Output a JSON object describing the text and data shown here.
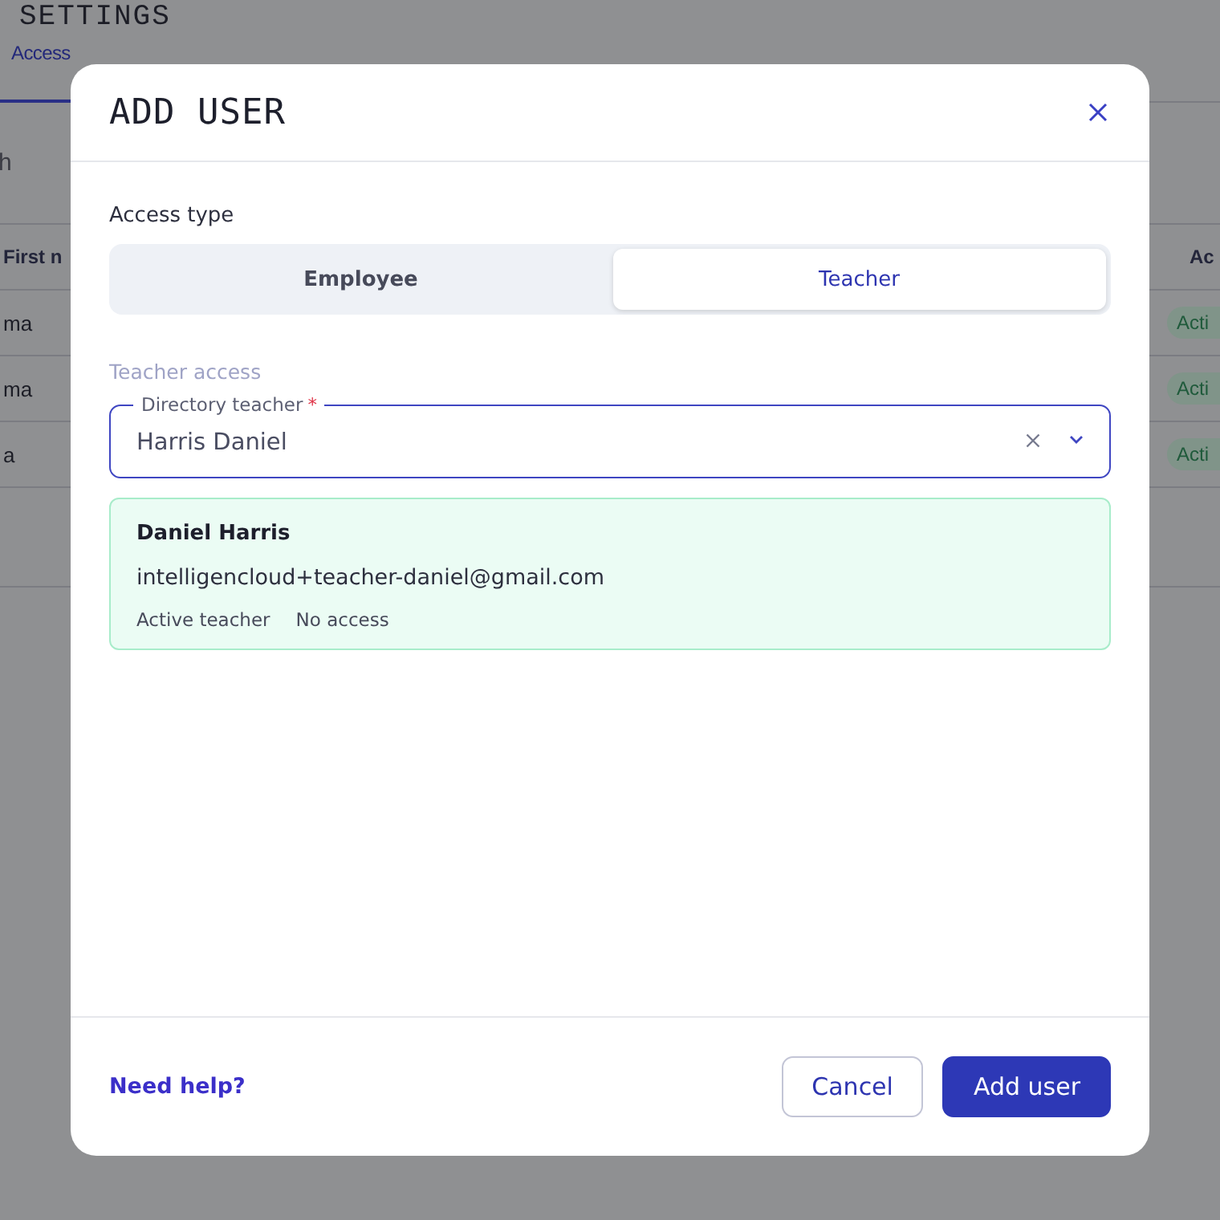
{
  "background": {
    "title": "SETTINGS",
    "tabs": [
      {
        "label": "Access",
        "selected": true
      }
    ],
    "search": {
      "placeholder": "h"
    },
    "table": {
      "columns": [
        "First n",
        "Ac"
      ],
      "rows": [
        {
          "first_name": "ma",
          "status": "Acti"
        },
        {
          "first_name": "ma",
          "status": "Acti"
        },
        {
          "first_name": "a",
          "status": "Acti"
        }
      ]
    }
  },
  "dialog": {
    "title": "ADD USER",
    "access_type": {
      "label": "Access type",
      "options": [
        {
          "label": "Employee",
          "selected": false
        },
        {
          "label": "Teacher",
          "selected": true
        }
      ]
    },
    "section_label": "Teacher access",
    "field": {
      "label": "Directory teacher",
      "required_mark": "*",
      "value": "Harris Daniel"
    },
    "teacher_card": {
      "name": "Daniel Harris",
      "email": "intelligencloud+teacher-daniel@gmail.com",
      "tags": [
        "Active teacher",
        "No access"
      ]
    },
    "help_link": "Need help?",
    "buttons": [
      {
        "label": "Cancel",
        "kind": "secondary"
      },
      {
        "label": "Add user",
        "kind": "primary"
      }
    ]
  }
}
